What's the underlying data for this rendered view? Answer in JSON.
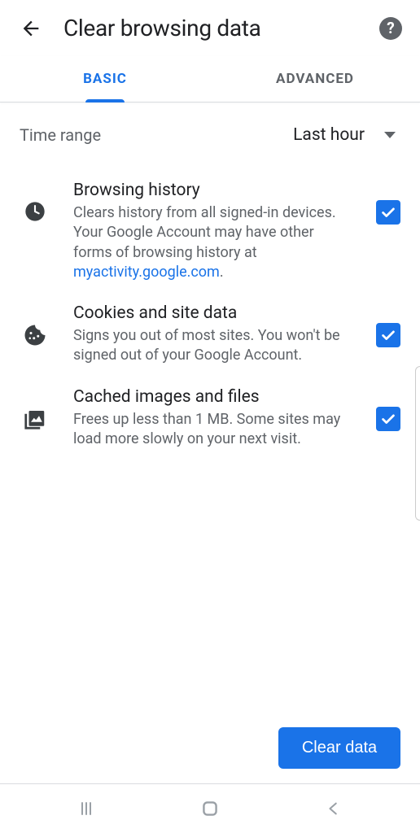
{
  "header": {
    "title": "Clear browsing data"
  },
  "tabs": {
    "basic": "BASIC",
    "advanced": "ADVANCED",
    "active": "basic"
  },
  "timeRange": {
    "label": "Time range",
    "value": "Last hour"
  },
  "options": [
    {
      "icon": "clock-icon",
      "title": "Browsing history",
      "desc_prefix": "Clears history from all signed-in devices. Your Google Account may have other forms of browsing history at ",
      "link_text": "myactivity.google.com",
      "desc_suffix": ".",
      "checked": true
    },
    {
      "icon": "cookie-icon",
      "title": "Cookies and site data",
      "desc": "Signs you out of most sites. You won't be signed out of your Google Account.",
      "checked": true
    },
    {
      "icon": "image-icon",
      "title": "Cached images and files",
      "desc": "Frees up less than 1 MB. Some sites may load more slowly on your next visit.",
      "checked": true
    }
  ],
  "footer": {
    "clear_button": "Clear data"
  },
  "colors": {
    "accent": "#1a73e8",
    "text_primary": "#202124",
    "text_secondary": "#5f6368"
  }
}
